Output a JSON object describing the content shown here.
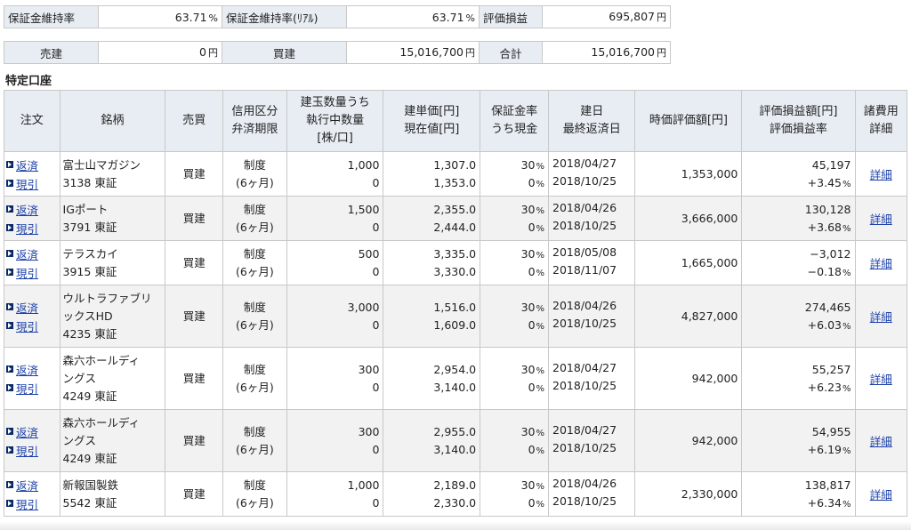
{
  "summary": {
    "margin_rate_label": "保証金維持率",
    "margin_rate_value": "63.71",
    "margin_rate_real_label": "保証金維持率(ﾘｱﾙ)",
    "margin_rate_real_value": "63.71",
    "pct_unit": "%",
    "valuation_label": "評価損益",
    "valuation_value": "695,807",
    "yen_unit": "円",
    "sell_label": "売建",
    "sell_value": "0",
    "buy_label": "買建",
    "buy_value": "15,016,700",
    "total_label": "合計",
    "total_value": "15,016,700"
  },
  "section_title": "特定口座",
  "headers": {
    "order": "注文",
    "stock": "銘柄",
    "side": "売買",
    "credit_l1": "信用区分",
    "credit_l2": "弁済期限",
    "qty_l1": "建玉数量うち",
    "qty_l2": "執行中数量",
    "qty_l3": "[株/口]",
    "price_l1": "建単価[円]",
    "price_l2": "現在値[円]",
    "margin_l1": "保証金率",
    "margin_l2": "うち現金",
    "date_l1": "建日",
    "date_l2": "最終返済日",
    "market_value": "時価評価額[円]",
    "pl_l1": "評価損益額[円]",
    "pl_l2": "評価損益率",
    "fee_l1": "諸費用",
    "fee_l2": "詳細"
  },
  "links": {
    "repay": "返済",
    "delivery": "現引",
    "detail": "詳細"
  },
  "rows": [
    {
      "name1": "富士山マガジン",
      "name2": "3138 東証",
      "side": "買建",
      "credit1": "制度",
      "credit2": "(6ヶ月)",
      "qty": "1,000",
      "qty_exec": "0",
      "open_price": "1,307.0",
      "cur_price": "1,353.0",
      "margin": "30",
      "cash": "0",
      "open_date": "2018/04/27",
      "last_date": "2018/10/25",
      "mv": "1,353,000",
      "pl": "45,197",
      "pl_rate": "+3.45"
    },
    {
      "name1": "IGポート",
      "name2": "3791 東証",
      "side": "買建",
      "credit1": "制度",
      "credit2": "(6ヶ月)",
      "qty": "1,500",
      "qty_exec": "0",
      "open_price": "2,355.0",
      "cur_price": "2,444.0",
      "margin": "30",
      "cash": "0",
      "open_date": "2018/04/26",
      "last_date": "2018/10/25",
      "mv": "3,666,000",
      "pl": "130,128",
      "pl_rate": "+3.68"
    },
    {
      "name1": "テラスカイ",
      "name2": "3915 東証",
      "side": "買建",
      "credit1": "制度",
      "credit2": "(6ヶ月)",
      "qty": "500",
      "qty_exec": "0",
      "open_price": "3,335.0",
      "cur_price": "3,330.0",
      "margin": "30",
      "cash": "0",
      "open_date": "2018/05/08",
      "last_date": "2018/11/07",
      "mv": "1,665,000",
      "pl": "−3,012",
      "pl_rate": "−0.18"
    },
    {
      "name1": "ウルトラファブリ",
      "name1b": "ックスHD",
      "name2": "4235 東証",
      "side": "買建",
      "credit1": "制度",
      "credit2": "(6ヶ月)",
      "qty": "3,000",
      "qty_exec": "0",
      "open_price": "1,516.0",
      "cur_price": "1,609.0",
      "margin": "30",
      "cash": "0",
      "open_date": "2018/04/26",
      "last_date": "2018/10/25",
      "mv": "4,827,000",
      "pl": "274,465",
      "pl_rate": "+6.03"
    },
    {
      "name1": "森六ホールディ",
      "name1b": "ングス",
      "name2": "4249 東証",
      "side": "買建",
      "credit1": "制度",
      "credit2": "(6ヶ月)",
      "qty": "300",
      "qty_exec": "0",
      "open_price": "2,954.0",
      "cur_price": "3,140.0",
      "margin": "30",
      "cash": "0",
      "open_date": "2018/04/27",
      "last_date": "2018/10/25",
      "mv": "942,000",
      "pl": "55,257",
      "pl_rate": "+6.23"
    },
    {
      "name1": "森六ホールディ",
      "name1b": "ングス",
      "name2": "4249 東証",
      "side": "買建",
      "credit1": "制度",
      "credit2": "(6ヶ月)",
      "qty": "300",
      "qty_exec": "0",
      "open_price": "2,955.0",
      "cur_price": "3,140.0",
      "margin": "30",
      "cash": "0",
      "open_date": "2018/04/27",
      "last_date": "2018/10/25",
      "mv": "942,000",
      "pl": "54,955",
      "pl_rate": "+6.19"
    },
    {
      "name1": "新報国製鉄",
      "name2": "5542 東証",
      "side": "買建",
      "credit1": "制度",
      "credit2": "(6ヶ月)",
      "qty": "1,000",
      "qty_exec": "0",
      "open_price": "2,189.0",
      "cur_price": "2,330.0",
      "margin": "30",
      "cash": "0",
      "open_date": "2018/04/26",
      "last_date": "2018/10/25",
      "mv": "2,330,000",
      "pl": "138,817",
      "pl_rate": "+6.34"
    }
  ]
}
